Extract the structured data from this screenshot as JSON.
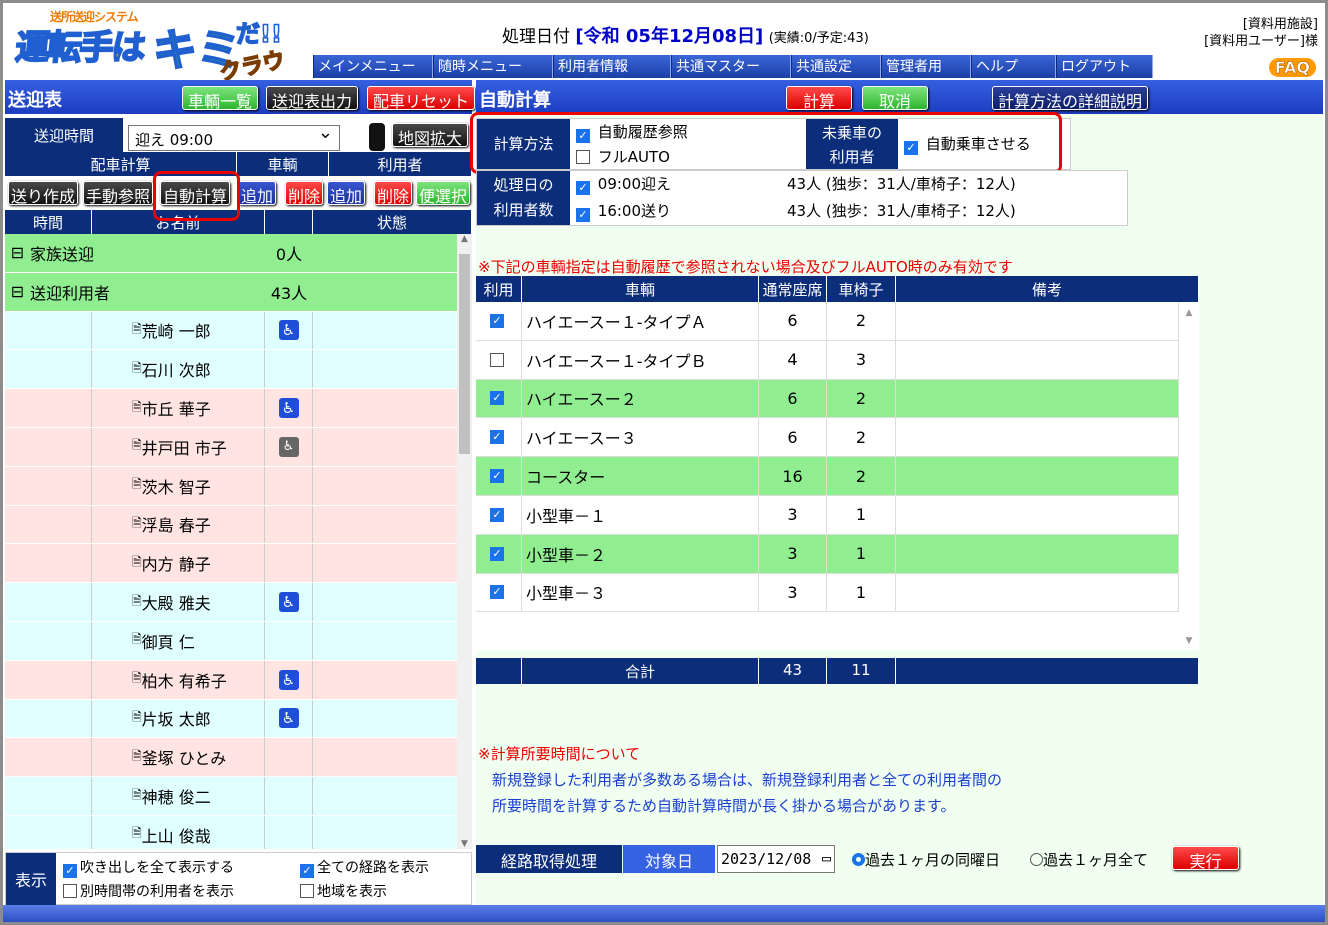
{
  "logo": {
    "sub": "送所送迎システム",
    "main": "運転手は",
    "main2": "キミ",
    "dada": "だ!!",
    "cloud": "クラウド"
  },
  "header": {
    "date_label": "処理日付",
    "date_value": "[令和 05年12月08日]",
    "date_extra": "(実績:0/予定:43)",
    "facility": "[資料用施設]",
    "user": "[資料用ユーザー]様",
    "faq": "FAQ"
  },
  "menu": [
    "メインメニュー",
    "随時メニュー",
    "利用者情報",
    "共通マスター",
    "共通設定",
    "管理者用",
    "ヘルプ",
    "ログアウト"
  ],
  "left": {
    "title": "送迎表",
    "btn_vehicles": "車輌一覧",
    "btn_output": "送迎表出力",
    "btn_reset": "配車リセット",
    "time_label": "送迎時間",
    "time_value": "迎え 09:00",
    "btn_map": "地図拡大",
    "grp_headers": [
      "配車計算",
      "車輌",
      "利用者"
    ],
    "btn_row": [
      "送り作成",
      "手動参照",
      "自動計算",
      "追加",
      "削除",
      "追加",
      "削除",
      "便選択"
    ],
    "col_headers": [
      "時間",
      "お名前",
      "",
      "状態"
    ],
    "groups": [
      {
        "name": "家族送迎",
        "count": "0人"
      },
      {
        "name": "送迎利用者",
        "count": "43人"
      }
    ],
    "people": [
      {
        "name": "荒崎 一郎",
        "icon": "wheelchair"
      },
      {
        "name": "石川 次郎",
        "icon": ""
      },
      {
        "name": "市丘 華子",
        "icon": "wheelchair"
      },
      {
        "name": "井戸田 市子",
        "icon": "walker"
      },
      {
        "name": "茨木 智子",
        "icon": ""
      },
      {
        "name": "浮島 春子",
        "icon": ""
      },
      {
        "name": "内方 静子",
        "icon": ""
      },
      {
        "name": "大殿 雅夫",
        "icon": "wheelchair"
      },
      {
        "name": "御頁 仁",
        "icon": ""
      },
      {
        "name": "柏木 有希子",
        "icon": "wheelchair"
      },
      {
        "name": "片坂 太郎",
        "icon": "wheelchair"
      },
      {
        "name": "釜塚 ひとみ",
        "icon": ""
      },
      {
        "name": "神穂 俊二",
        "icon": ""
      },
      {
        "name": "上山 俊哉",
        "icon": ""
      }
    ],
    "footer": {
      "label": "表示",
      "opt1": "吹き出しを全て表示する",
      "opt2": "全ての経路を表示",
      "opt3": "別時間帯の利用者を表示",
      "opt4": "地域を表示"
    }
  },
  "right": {
    "title": "自動計算",
    "btn_calc": "計算",
    "btn_cancel": "取消",
    "btn_detail": "計算方法の詳細説明",
    "method_label": "計算方法",
    "method_opt1": "自動履歴参照",
    "method_opt2": "フルAUTO",
    "unboard_label": "未乗車の\n利用者",
    "unboard_opt": "自動乗車させる",
    "users_label": "処理日の\n利用者数",
    "users": [
      {
        "time": "09:00迎え",
        "count": "43人 (独歩：31人/車椅子：12人)"
      },
      {
        "time": "16:00送り",
        "count": "43人 (独歩：31人/車椅子：12人)"
      }
    ],
    "warn": "※下記の車輌指定は自動履歴で参照されない場合及びフルAUTO時のみ有効です",
    "tbl_headers": [
      "利用",
      "車輌",
      "通常座席",
      "車椅子",
      "備考"
    ],
    "vehicles": [
      {
        "name": "ハイエースー１-タイプＡ",
        "seats": "6",
        "wc": "2",
        "checked": true
      },
      {
        "name": "ハイエースー１-タイプＢ",
        "seats": "4",
        "wc": "3",
        "checked": false
      },
      {
        "name": "ハイエースー２",
        "seats": "6",
        "wc": "2",
        "checked": true
      },
      {
        "name": "ハイエースー３",
        "seats": "6",
        "wc": "2",
        "checked": true
      },
      {
        "name": "コースター",
        "seats": "16",
        "wc": "2",
        "checked": true
      },
      {
        "name": "小型車－１",
        "seats": "3",
        "wc": "1",
        "checked": true
      },
      {
        "name": "小型車－２",
        "seats": "3",
        "wc": "1",
        "checked": true
      },
      {
        "name": "小型車－３",
        "seats": "3",
        "wc": "1",
        "checked": true
      }
    ],
    "total_label": "合計",
    "total_seats": "43",
    "total_wc": "11",
    "note_title": "※計算所要時間について",
    "note1": "新規登録した利用者が多数ある場合は、新規登録利用者と全ての利用者間の",
    "note2": "所要時間を計算するため自動計算時間が長く掛かる場合があります。",
    "route_label": "経路取得処理",
    "target_label": "対象日",
    "target_date": "2023/12/08",
    "radio1": "過去１ヶ月の同曜日",
    "radio2": "過去１ヶ月全て",
    "btn_exec": "実行"
  },
  "colors": {
    "navy": "#0b2d7a",
    "green_row": "#90ee90",
    "pink_row": "#ffe4e1",
    "blue_row": "#e0ffff",
    "highlight": "#e00000"
  }
}
